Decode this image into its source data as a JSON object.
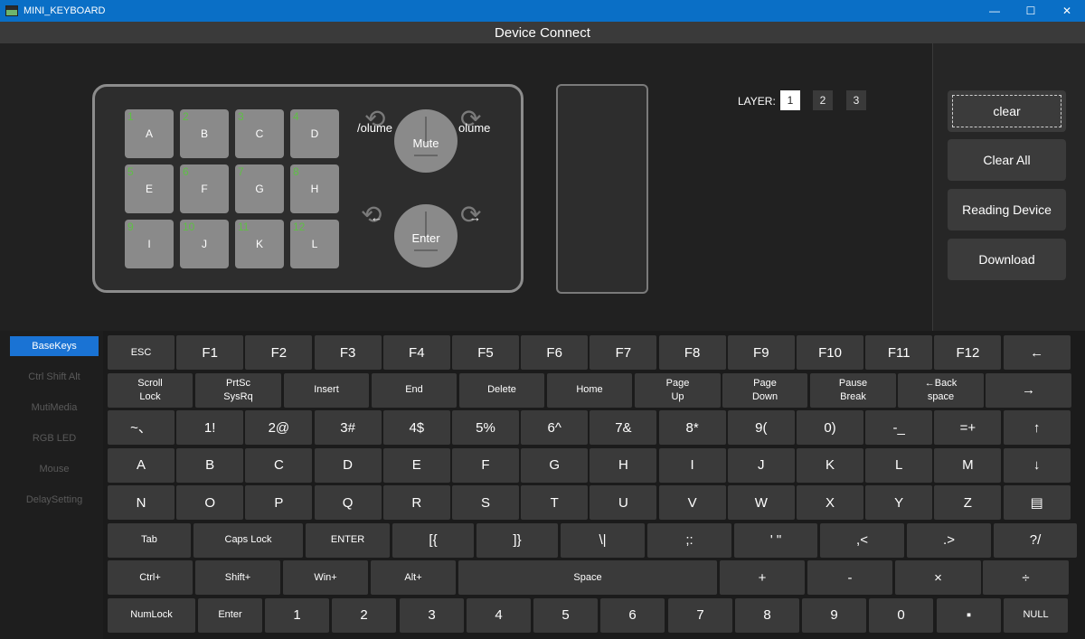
{
  "window": {
    "title": "MINI_KEYBOARD",
    "controls": [
      "—",
      "☐",
      "✕"
    ]
  },
  "header": {
    "title": "Device Connect"
  },
  "layers": {
    "label": "LAYER:",
    "items": [
      "1",
      "2",
      "3"
    ],
    "active": "1"
  },
  "device_keys": [
    {
      "num": "1",
      "label": "A"
    },
    {
      "num": "2",
      "label": "B"
    },
    {
      "num": "3",
      "label": "C"
    },
    {
      "num": "4",
      "label": "D"
    },
    {
      "num": "5",
      "label": "E"
    },
    {
      "num": "6",
      "label": "F"
    },
    {
      "num": "7",
      "label": "G"
    },
    {
      "num": "8",
      "label": "H"
    },
    {
      "num": "9",
      "label": "I"
    },
    {
      "num": "10",
      "label": "J"
    },
    {
      "num": "11",
      "label": "K"
    },
    {
      "num": "12",
      "label": "L"
    }
  ],
  "knobs": [
    {
      "label": "Mute",
      "left_text": "/olume",
      "right_text": "olume"
    },
    {
      "label": "Enter",
      "left_text": "←",
      "right_text": "→"
    }
  ],
  "actions": [
    "clear",
    "Clear All",
    "Reading Device",
    "Download"
  ],
  "sidebar": {
    "items": [
      "BaseKeys",
      "Ctrl Shift Alt",
      "MutiMedia",
      "RGB LED",
      "Mouse",
      "DelaySetting"
    ],
    "active": "BaseKeys"
  },
  "keyboard": {
    "rows": [
      [
        "ESC",
        "F1",
        "F2",
        "F3",
        "F4",
        "F5",
        "F6",
        "F7",
        "F8",
        "F9",
        "F10",
        "F11",
        "F12",
        "←"
      ],
      [
        "Scroll\nLock",
        "PrtSc\nSysRq",
        "Insert",
        "End",
        "Delete",
        "Home",
        "Page\nUp",
        "Page\nDown",
        "Pause\nBreak",
        "←Back\nspace",
        "→"
      ],
      [
        "~、",
        "1!",
        "2@",
        "3#",
        "4$",
        "5%",
        "6^",
        "7&",
        "8*",
        "9(",
        "0)",
        "-_",
        "=+",
        "↑"
      ],
      [
        "A",
        "B",
        "C",
        "D",
        "E",
        "F",
        "G",
        "H",
        "I",
        "J",
        "K",
        "L",
        "M",
        "↓"
      ],
      [
        "N",
        "O",
        "P",
        "Q",
        "R",
        "S",
        "T",
        "U",
        "V",
        "W",
        "X",
        "Y",
        "Z",
        "▤"
      ],
      [
        "Tab",
        "Caps Lock",
        "ENTER",
        "[{",
        "]}",
        "\\|",
        ";:",
        "' \"",
        ",<",
        ".>",
        "?/"
      ],
      [
        "Ctrl+",
        "Shift+",
        "Win+",
        "Alt+",
        "Space",
        "+",
        "-",
        "×",
        "÷"
      ],
      [
        "NumLock",
        "Enter",
        "1",
        "2",
        "3",
        "4",
        "5",
        "6",
        "7",
        "8",
        "9",
        "0",
        "▪",
        "NULL"
      ]
    ]
  },
  "icons": {
    "app": "app-keyboard-icon",
    "rotate_ccw": "rotate-ccw-icon",
    "rotate_cw": "rotate-cw-icon"
  },
  "colors": {
    "title_bar": "#0a6fc6",
    "active_tab": "#1a73d4",
    "key_number": "#5fbf45"
  }
}
